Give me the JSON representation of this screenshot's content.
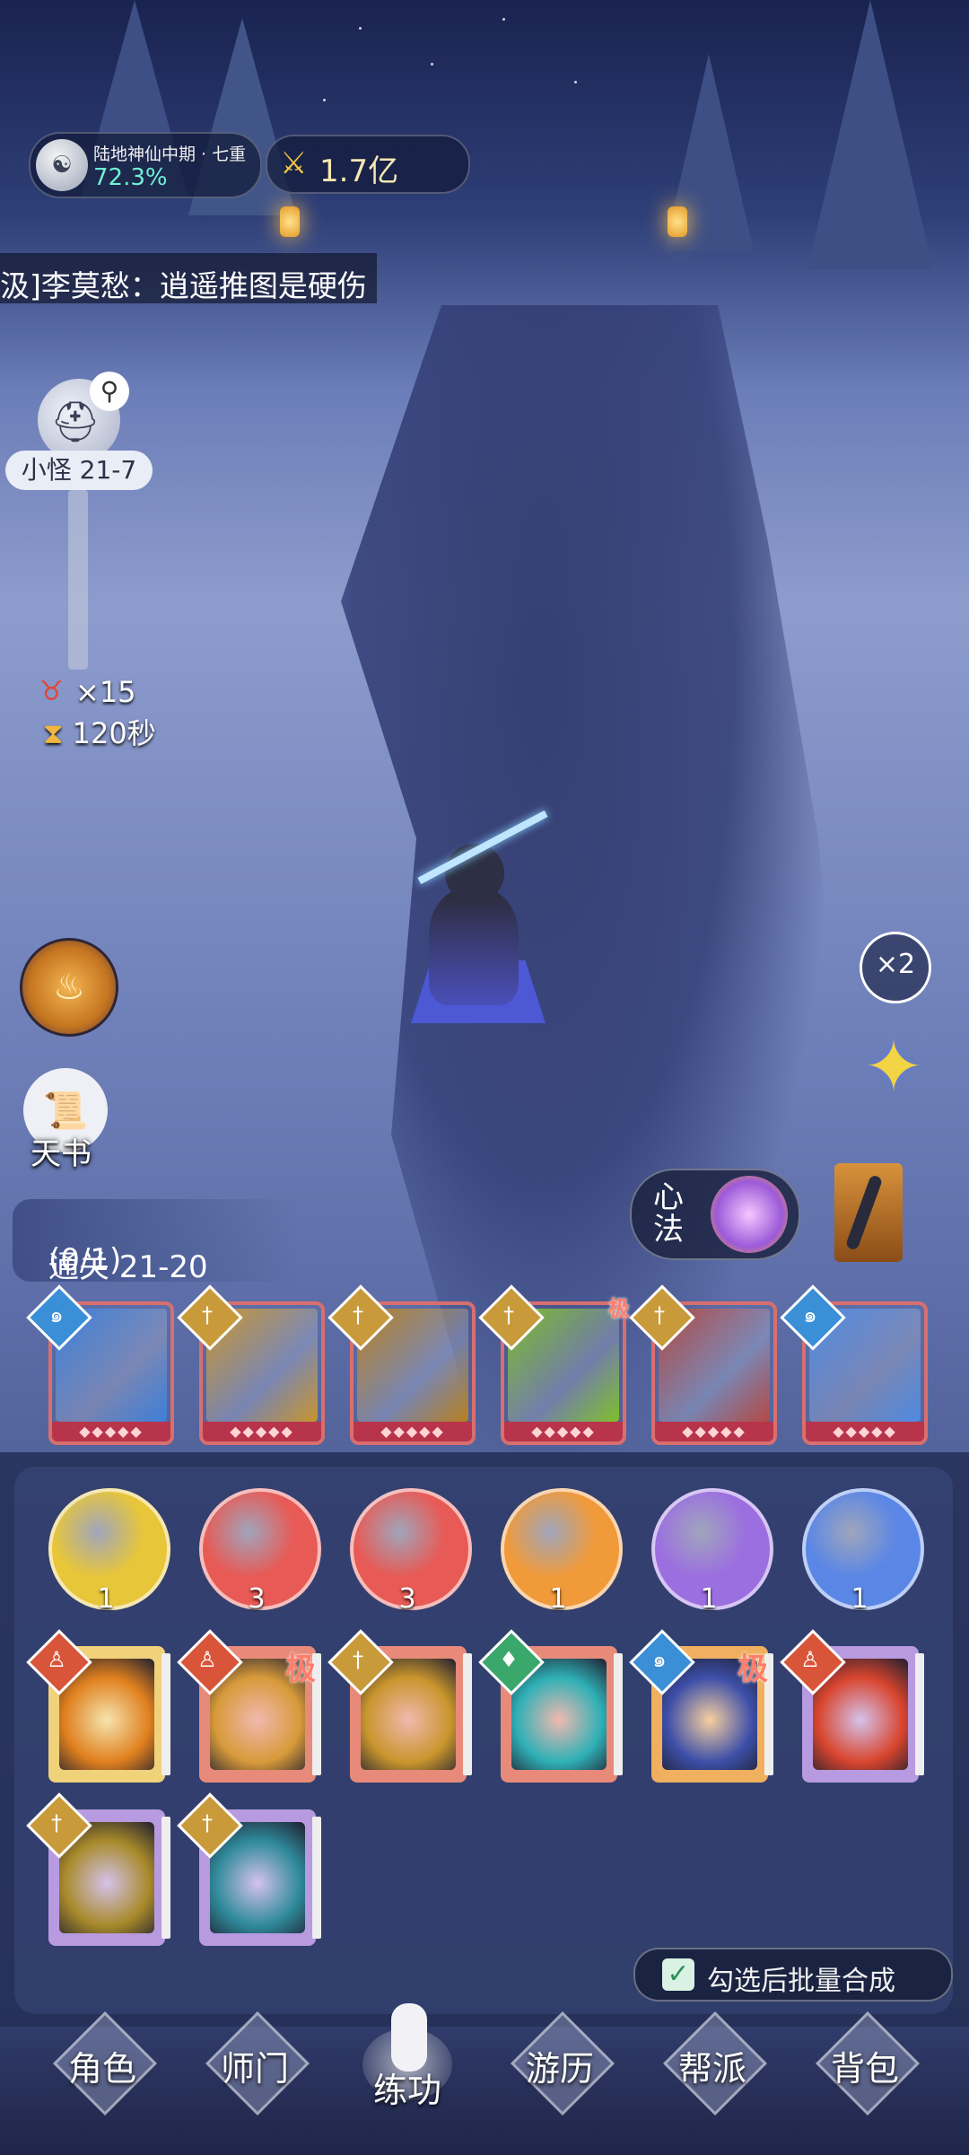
{
  "hud": {
    "realm_name": "陆地神仙中期 · 七重",
    "realm_progress": "72.3%",
    "power_value": "1.7亿",
    "power_icon": "crossed-swords-icon"
  },
  "chat": {
    "message": "汲]李莫愁：逍遥推图是硬伤"
  },
  "stage": {
    "monster_label": "小怪 21-7",
    "kill_count": "×15",
    "time_left": "120秒",
    "clear_label": "通关 21-20",
    "clear_progress": "(0/1)"
  },
  "left_buttons": {
    "book_label": "天书"
  },
  "right_buttons": {
    "speed_label": "×2"
  },
  "xinfa": {
    "label": "心法"
  },
  "equipped_skills": [
    {
      "badge": "spiral",
      "badge_color": "#3a8fd6",
      "art": "#3e7fd8",
      "stars": "◆◆◆◆◆",
      "extreme": ""
    },
    {
      "badge": "sword",
      "badge_color": "#c89a3a",
      "art": "#c9952d",
      "stars": "◆◆◆◆◆",
      "extreme": ""
    },
    {
      "badge": "sword",
      "badge_color": "#c89a3a",
      "art": "#b8801e",
      "stars": "◆◆◆◆◆",
      "extreme": ""
    },
    {
      "badge": "sword",
      "badge_color": "#c89a3a",
      "art": "#7fbf2a",
      "stars": "◆◆◆◆◆",
      "extreme": "极"
    },
    {
      "badge": "sword",
      "badge_color": "#c89a3a",
      "art": "#b44a44",
      "stars": "◆◆◆◆◆",
      "extreme": ""
    },
    {
      "badge": "spiral",
      "badge_color": "#3a8fd6",
      "art": "#4f8ae0",
      "stars": "◆◆◆◆◆",
      "extreme": ""
    }
  ],
  "orbs": [
    {
      "count": "1",
      "color": "#e8c63a"
    },
    {
      "count": "3",
      "color": "#e85a55"
    },
    {
      "count": "3",
      "color": "#e85a55"
    },
    {
      "count": "1",
      "color": "#f09a3a"
    },
    {
      "count": "1",
      "color": "#9c6fe0"
    },
    {
      "count": "1",
      "color": "#5a86e6"
    }
  ],
  "inventory_skills": [
    {
      "badge": "meditate",
      "badge_color": "#d8553a",
      "frame": "#f0d27a",
      "art": "#e0801e",
      "extreme": ""
    },
    {
      "badge": "meditate",
      "badge_color": "#d8553a",
      "frame": "#e88a7a",
      "art": "#d89a3a",
      "extreme": "极"
    },
    {
      "badge": "sword",
      "badge_color": "#c89a3a",
      "frame": "#e88a7a",
      "art": "#c9952d",
      "extreme": ""
    },
    {
      "badge": "leaf",
      "badge_color": "#3aa86a",
      "frame": "#e88a7a",
      "art": "#2fb0b6",
      "extreme": ""
    },
    {
      "badge": "spiral",
      "badge_color": "#3a8fd6",
      "frame": "#f0b060",
      "art": "#3d4fa8",
      "extreme": "极"
    },
    {
      "badge": "meditate",
      "badge_color": "#d8553a",
      "frame": "#b89ae0",
      "art": "#d8452e",
      "extreme": ""
    },
    {
      "badge": "sword",
      "badge_color": "#c89a3a",
      "frame": "#b89ae0",
      "art": "#a88a2a",
      "extreme": ""
    },
    {
      "badge": "sword",
      "badge_color": "#c89a3a",
      "frame": "#b89ae0",
      "art": "#2f8a9a",
      "extreme": ""
    }
  ],
  "merge": {
    "label": "勾选后批量合成",
    "checked": true
  },
  "nav": [
    {
      "label": "角色",
      "active": false
    },
    {
      "label": "师门",
      "active": false
    },
    {
      "label": "练功",
      "active": true
    },
    {
      "label": "游历",
      "active": false
    },
    {
      "label": "帮派",
      "active": false
    },
    {
      "label": "背包",
      "active": false
    }
  ]
}
